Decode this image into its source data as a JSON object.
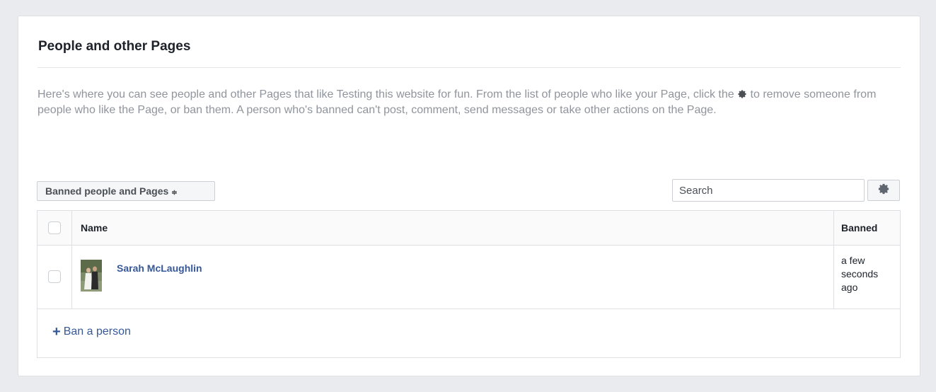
{
  "section": {
    "title": "People and other Pages",
    "description_part1": "Here's where you can see people and other Pages that like Testing this website for fun. From the list of people who like your Page, click the",
    "description_part2": "to remove someone from people who like the Page, or ban them. A person who's banned can't post, comment, send messages or take other actions on the Page."
  },
  "toolbar": {
    "filter_selected": "Banned people and Pages",
    "filter_arrows": "≑",
    "search_placeholder": "Search",
    "settings_icon": "gear-icon"
  },
  "table": {
    "columns": [
      "Name",
      "Banned"
    ],
    "rows": [
      {
        "name": "Sarah McLaughlin",
        "banned": "a few seconds ago"
      }
    ],
    "footer_action": "Ban a person",
    "footer_plus": "+"
  },
  "colors": {
    "link": "#365899",
    "muted_text": "#90949c",
    "page_bg": "#e9ebee"
  }
}
